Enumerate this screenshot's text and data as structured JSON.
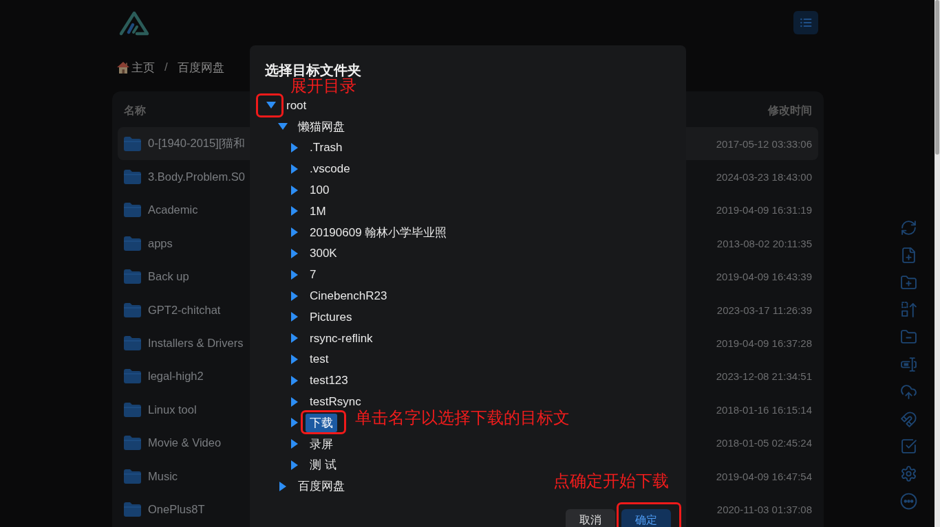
{
  "header": {
    "breadcrumb": {
      "items": [
        {
          "label": "主页",
          "kind": "home"
        },
        {
          "label": "百度网盘",
          "kind": "folder"
        }
      ],
      "separator": "/"
    }
  },
  "file_table": {
    "columns": [
      "名称",
      "修改时间"
    ],
    "rows": [
      {
        "name": "0-[1940-2015][猫和",
        "modified": "2017-05-12 03:33:06",
        "highlighted": true
      },
      {
        "name": "3.Body.Problem.S0",
        "modified": "2024-03-23 18:43:00",
        "highlighted": false
      },
      {
        "name": "Academic",
        "modified": "2019-04-09 16:31:19",
        "highlighted": false
      },
      {
        "name": "apps",
        "modified": "2013-08-02 20:11:35",
        "highlighted": false
      },
      {
        "name": "Back up",
        "modified": "2019-04-09 16:43:39",
        "highlighted": false
      },
      {
        "name": "GPT2-chitchat",
        "modified": "2023-03-17 11:26:39",
        "highlighted": false
      },
      {
        "name": "Installers & Drivers",
        "modified": "2019-04-09 16:37:28",
        "highlighted": false
      },
      {
        "name": "legal-high2",
        "modified": "2023-12-08 21:34:51",
        "highlighted": false
      },
      {
        "name": "Linux tool",
        "modified": "2018-01-16 16:15:14",
        "highlighted": false
      },
      {
        "name": "Movie & Video",
        "modified": "2018-01-05 02:45:24",
        "highlighted": false
      },
      {
        "name": "Music",
        "modified": "2019-04-09 16:47:54",
        "highlighted": false
      },
      {
        "name": "OnePlus8T",
        "modified": "2020-11-03 01:37:08",
        "highlighted": false
      }
    ]
  },
  "dialog": {
    "title": "选择目标文件夹",
    "tree": [
      {
        "label": "root",
        "expanded": true,
        "selected": false,
        "children": [
          {
            "label": "懒猫网盘",
            "expanded": true,
            "selected": false,
            "children": [
              {
                "label": ".Trash",
                "expanded": false,
                "selected": false
              },
              {
                "label": ".vscode",
                "expanded": false,
                "selected": false
              },
              {
                "label": "100",
                "expanded": false,
                "selected": false
              },
              {
                "label": "1M",
                "expanded": false,
                "selected": false
              },
              {
                "label": "20190609 翰林小学毕业照",
                "expanded": false,
                "selected": false
              },
              {
                "label": "300K",
                "expanded": false,
                "selected": false
              },
              {
                "label": "7",
                "expanded": false,
                "selected": false
              },
              {
                "label": "CinebenchR23",
                "expanded": false,
                "selected": false
              },
              {
                "label": "Pictures",
                "expanded": false,
                "selected": false
              },
              {
                "label": "rsync-reflink",
                "expanded": false,
                "selected": false
              },
              {
                "label": "test",
                "expanded": false,
                "selected": false
              },
              {
                "label": "test123",
                "expanded": false,
                "selected": false
              },
              {
                "label": "testRsync",
                "expanded": false,
                "selected": false
              },
              {
                "label": "下载",
                "expanded": false,
                "selected": true
              },
              {
                "label": "录屏",
                "expanded": false,
                "selected": false
              },
              {
                "label": "测 试",
                "expanded": false,
                "selected": false
              }
            ]
          },
          {
            "label": "百度网盘",
            "expanded": false,
            "selected": false
          }
        ]
      }
    ],
    "buttons": [
      {
        "label": "取消",
        "kind": "secondary"
      },
      {
        "label": "确定",
        "kind": "primary"
      }
    ]
  },
  "annotations": [
    {
      "text": "展开目录"
    },
    {
      "text": "单击名字以选择下载的目标文"
    },
    {
      "text": "点确定开始下载"
    }
  ]
}
